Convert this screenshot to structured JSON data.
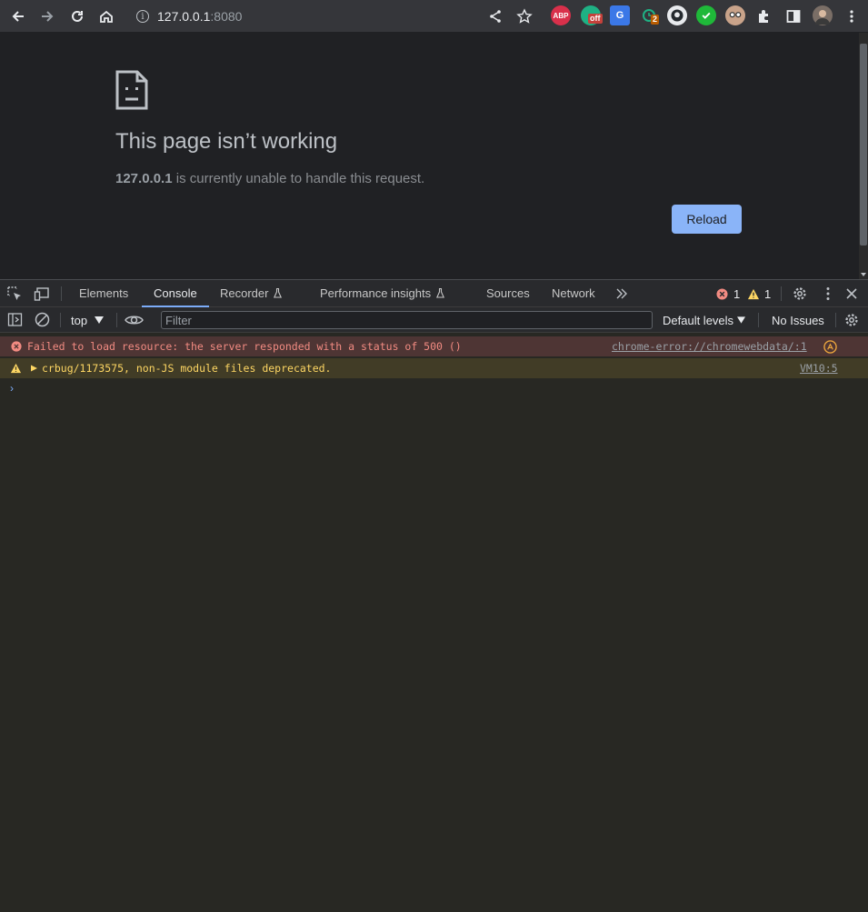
{
  "browser": {
    "url_host": "127.0.0.1",
    "url_port": ":8080",
    "extensions": [
      {
        "name": "ABP",
        "color": "#d9304b"
      },
      {
        "name": "off",
        "color": "#1fb184"
      },
      {
        "name": "G",
        "color": "#3b78e7"
      },
      {
        "name": "2",
        "color": "#1e6f5c"
      }
    ]
  },
  "page": {
    "title": "This page isn’t working",
    "host_bold": "127.0.0.1",
    "message": " is currently unable to handle this request.",
    "reload_label": "Reload"
  },
  "devtools": {
    "tabs": [
      "Elements",
      "Console",
      "Recorder",
      "Performance insights",
      "Sources",
      "Network"
    ],
    "active_tab": "Console",
    "error_count": "1",
    "warning_count": "1",
    "context": "top",
    "filter_placeholder": "Filter",
    "levels": "Default levels",
    "issues": "No Issues"
  },
  "console": {
    "messages": [
      {
        "level": "error",
        "text": "Failed to load resource: the server responded with a status of 500 ()",
        "source": "chrome-error://chromewebdata/:1"
      },
      {
        "level": "warning",
        "text": "crbug/1173575, non-JS module files deprecated.",
        "source": "VM10:5"
      }
    ],
    "prompt": "›"
  }
}
